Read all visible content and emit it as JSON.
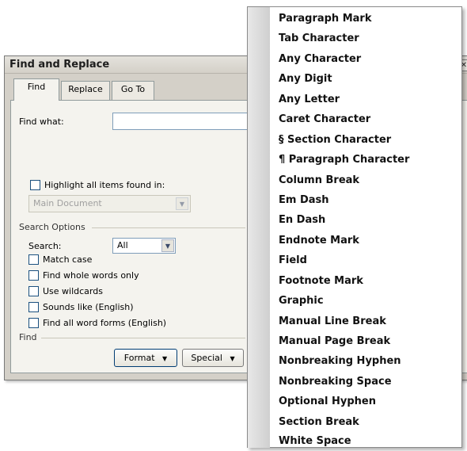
{
  "window": {
    "title": "Find and Replace",
    "help_glyph": "?",
    "close_glyph": "✕"
  },
  "tabs": [
    "Find",
    "Replace",
    "Go To"
  ],
  "find_what_label": "Find what:",
  "highlight_label": "Highlight all items found in:",
  "highlight_scope": "Main Document",
  "search_options_label": "Search Options",
  "search_label": "Search:",
  "search_value": "All",
  "options": [
    "Match case",
    "Find whole words only",
    "Use wildcards",
    "Sounds like (English)",
    "Find all word forms (English)"
  ],
  "find_group_label": "Find",
  "format_button": "Format",
  "special_button": "Special",
  "dropdown_glyph": "▼",
  "menu_items": [
    "Paragraph Mark",
    "Tab Character",
    "Any Character",
    "Any Digit",
    "Any Letter",
    "Caret Character",
    "§ Section Character",
    "¶ Paragraph Character",
    "Column Break",
    "Em Dash",
    "En Dash",
    "Endnote Mark",
    "Field",
    "Footnote Mark",
    "Graphic",
    "Manual Line Break",
    "Manual Page Break",
    "Nonbreaking Hyphen",
    "Nonbreaking Space",
    "Optional Hyphen",
    "Section Break",
    "White Space"
  ]
}
